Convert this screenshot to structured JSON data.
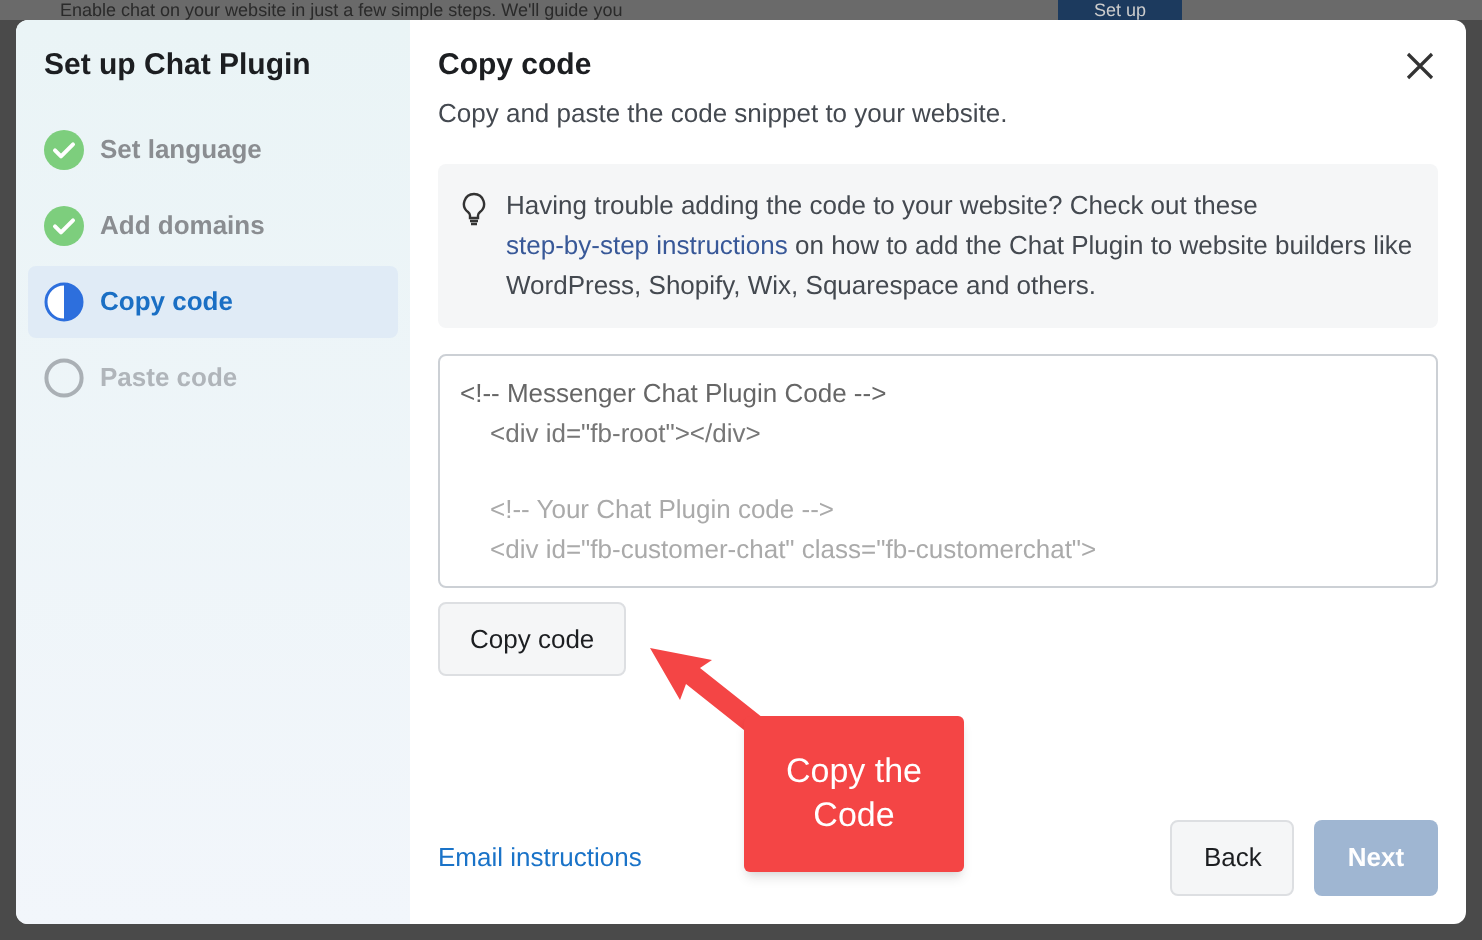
{
  "backdrop": {
    "text": "Enable chat on your website in just a few simple steps. We'll guide you",
    "button": "Set up"
  },
  "sidebar": {
    "title": "Set up Chat Plugin",
    "steps": [
      {
        "label": "Set language",
        "kind": "done",
        "selected": false
      },
      {
        "label": "Add domains",
        "kind": "done",
        "selected": false
      },
      {
        "label": "Copy code",
        "kind": "current",
        "selected": true
      },
      {
        "label": "Paste code",
        "kind": "todo",
        "selected": false
      }
    ]
  },
  "main": {
    "title": "Copy code",
    "subtitle": "Copy and paste the code snippet to your website.",
    "tip": {
      "before": "Having trouble adding the code to your website? Check out these",
      "link": "step-by-step instructions",
      "after": "on how to add the Chat Plugin to website builders like WordPress, Shopify, Wix, Squarespace and others."
    },
    "code": {
      "header": "<!-- Messenger Chat Plugin Code -->",
      "children": [
        [
          "<div id=\"fb-root\"></div>"
        ],
        [
          "<!-- Your Chat Plugin code -->",
          "<div id=\"fb-customer-chat\" class=\"fb-customerchat\">"
        ]
      ]
    },
    "copy_button": "Copy code",
    "email_link": "Email instructions",
    "buttons": [
      {
        "label": "Back",
        "disabled": false
      },
      {
        "label": "Next",
        "disabled": true
      }
    ]
  },
  "callout": {
    "text": "Copy the Code"
  }
}
